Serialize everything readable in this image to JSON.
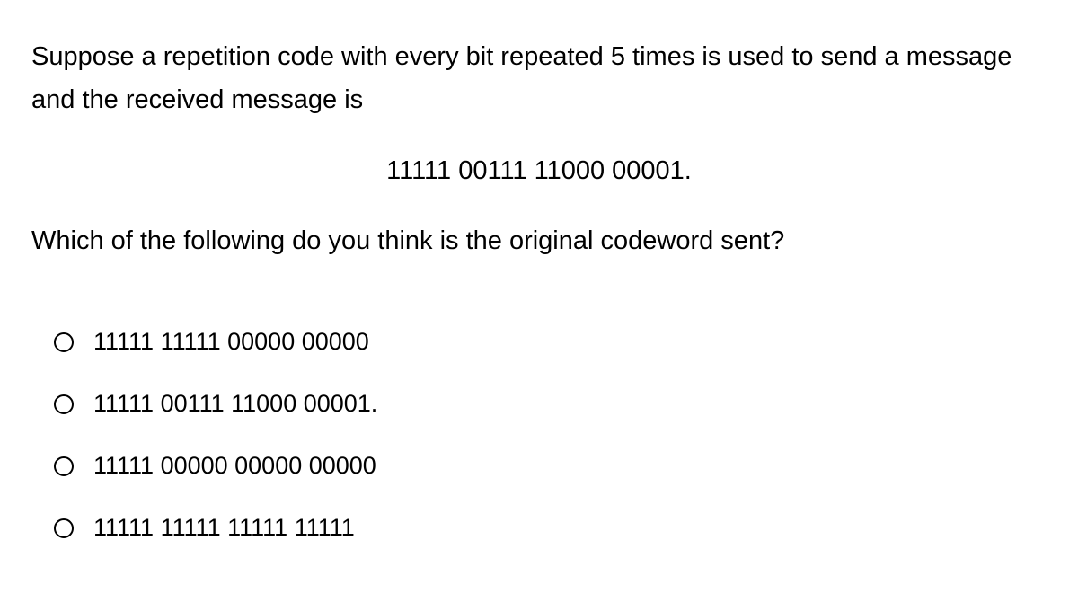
{
  "question": {
    "intro": "Suppose a repetition code with every bit repeated 5 times is used to send a message and the received message is",
    "received_message": "11111 00111 11000 00001.",
    "prompt": "Which of the following do you think is the original codeword sent?"
  },
  "options": [
    {
      "label": "11111 11111 00000 00000"
    },
    {
      "label": "11111 00111 11000 00001."
    },
    {
      "label": "11111 00000 00000 00000"
    },
    {
      "label": "11111 11111 11111 11111"
    }
  ]
}
